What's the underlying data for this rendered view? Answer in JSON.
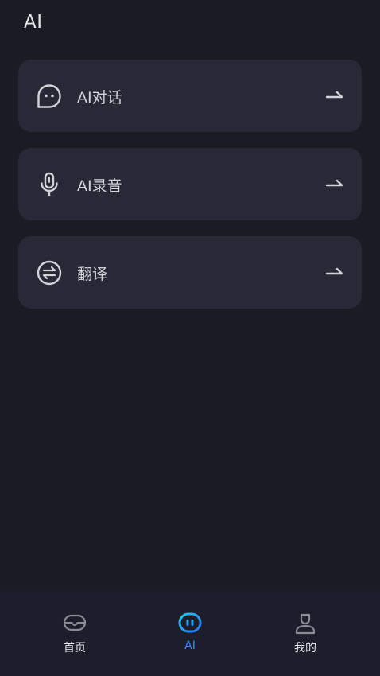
{
  "header": {
    "title": "AI"
  },
  "cards": [
    {
      "label": "AI对话",
      "icon": "chat-bubble-icon",
      "arrow_icon": "arrow-right-icon"
    },
    {
      "label": "AI录音",
      "icon": "microphone-icon",
      "arrow_icon": "arrow-right-icon"
    },
    {
      "label": "翻译",
      "icon": "translate-swap-icon",
      "arrow_icon": "arrow-right-icon"
    }
  ],
  "tabbar": {
    "active": "AI",
    "accent_color": "#3b8bf0",
    "tabs": [
      {
        "label": "首页",
        "icon": "home-icon"
      },
      {
        "label": "AI",
        "icon": "robot-face-icon"
      },
      {
        "label": "我的",
        "icon": "profile-icon"
      }
    ]
  }
}
